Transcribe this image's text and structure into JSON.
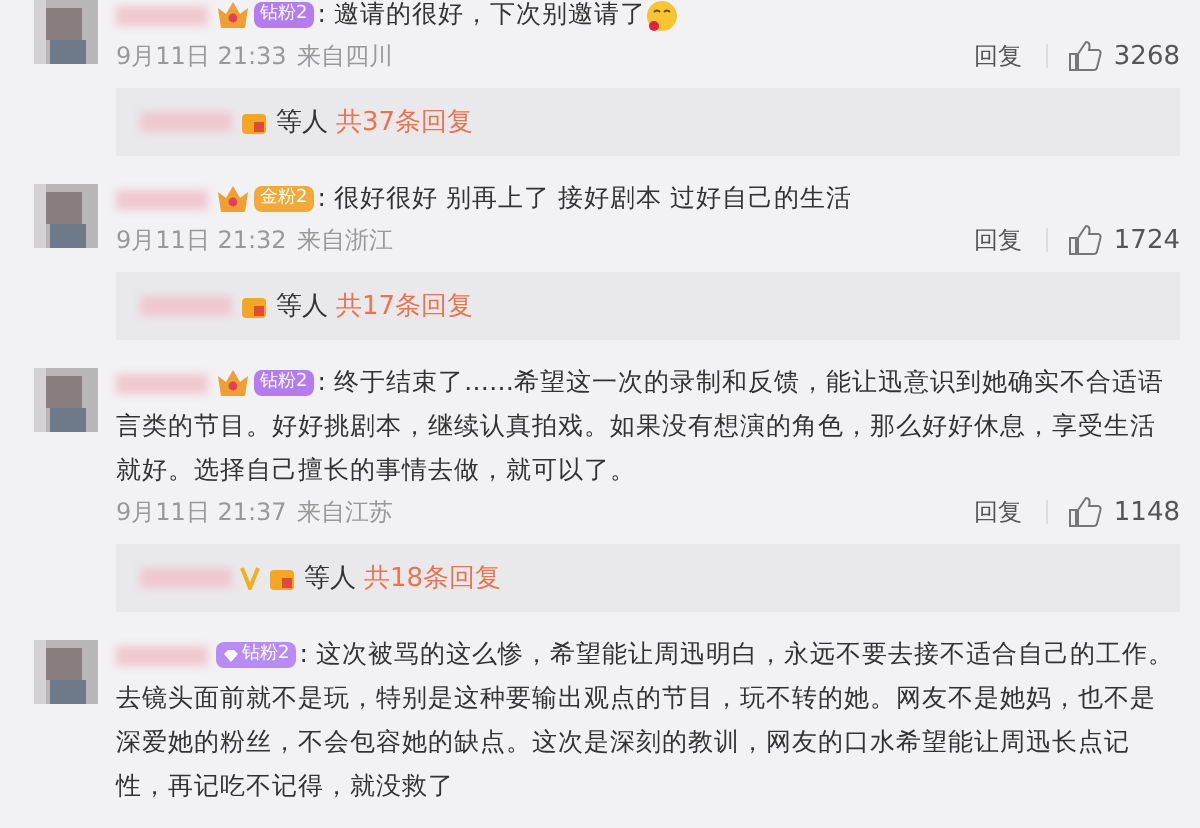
{
  "comments": [
    {
      "badge": {
        "kind": "diamond",
        "label": "钻粉2"
      },
      "separator": ":",
      "text": "邀请的很好，下次别邀请了",
      "emoji": true,
      "time": "9月11日 21:33",
      "location": "来自四川",
      "reply_label": "回复",
      "likes": "3268",
      "replies": {
        "suffix": "等人",
        "count": "共37条回复"
      }
    },
    {
      "badge": {
        "kind": "gold",
        "label": "金粉2"
      },
      "separator": ":",
      "text": "很好很好 别再上了 接好剧本 过好自己的生活",
      "time": "9月11日 21:32",
      "location": "来自浙江",
      "reply_label": "回复",
      "likes": "1724",
      "replies": {
        "suffix": "等人",
        "count": "共17条回复"
      }
    },
    {
      "badge": {
        "kind": "diamond",
        "label": "钻粉2"
      },
      "separator": ":",
      "text": "终于结束了……希望这一次的录制和反馈，能让迅意识到她确实不合适语言类的节目。好好挑剧本，继续认真拍戏。如果没有想演的角色，那么好好休息，享受生活就好。选择自己擅长的事情去做，就可以了。",
      "time": "9月11日 21:37",
      "location": "来自江苏",
      "reply_label": "回复",
      "likes": "1148",
      "replies": {
        "verified": true,
        "suffix": "等人",
        "count": "共18条回复"
      }
    },
    {
      "badge": {
        "kind": "gem",
        "label": "钻粉2"
      },
      "separator": ":",
      "text": "这次被骂的这么惨，希望能让周迅明白，永远不要去接不适合自己的工作。去镜头面前就不是玩，特别是这种要输出观点的节目，玩不转的她。网友不是她妈，也不是深爱她的粉丝，不会包容她的缺点。这次是深刻的教训，网友的口水希望能让周迅长点记性，再记吃不记得，就没救了"
    }
  ]
}
